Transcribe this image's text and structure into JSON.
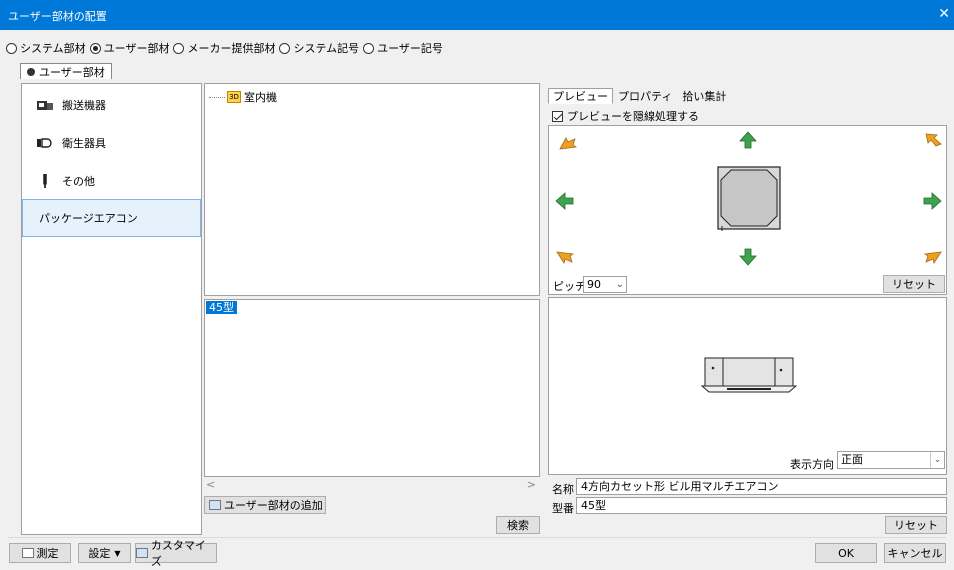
{
  "window": {
    "title": "ユーザー部材の配置",
    "close_glyph": "✕"
  },
  "source_options": [
    {
      "label": "システム部材",
      "selected": false
    },
    {
      "label": "ユーザー部材",
      "selected": true
    },
    {
      "label": "メーカー提供部材",
      "selected": false
    },
    {
      "label": "システム記号",
      "selected": false
    },
    {
      "label": "ユーザー記号",
      "selected": false
    }
  ],
  "source_tab": {
    "label": "ユーザー部材"
  },
  "categories": [
    {
      "label": "搬送機器",
      "icon": "conveyor-icon"
    },
    {
      "label": "衛生器具",
      "icon": "sanitary-icon"
    },
    {
      "label": "その他",
      "icon": "other-icon"
    },
    {
      "label": "パッケージエアコン",
      "icon": "",
      "selected": true
    }
  ],
  "tree": {
    "node_label": "室内機",
    "node_icon_text": "3D"
  },
  "model_list": {
    "items": [
      "45型"
    ]
  },
  "buttons": {
    "add_user_part": "ユーザー部材の追加",
    "search": "検索",
    "pitch_reset": "リセット",
    "field_reset": "リセット",
    "measure": "測定",
    "settings": "設定",
    "customize": "カスタマイズ",
    "ok": "OK",
    "cancel": "キャンセル"
  },
  "right_tabs": [
    {
      "label": "プレビュー",
      "active": true
    },
    {
      "label": "プロパティ",
      "active": false
    },
    {
      "label": "拾い集計",
      "active": false
    }
  ],
  "preview": {
    "hidden_line_label": "プレビューを隠線処理する",
    "hidden_line_checked": true,
    "pitch_label": "ピッチ",
    "pitch_value": "90",
    "direction_label": "表示方向",
    "direction_value": "正面"
  },
  "fields": {
    "name_label": "名称",
    "name_value": "4方向カセット形 ビル用マルチエアコン",
    "model_label": "型番",
    "model_value": "45型"
  },
  "colors": {
    "titlebar": "#0078d7",
    "selection": "#0078d7",
    "arrow_green": "#3fa34d",
    "arrow_orange": "#f0a020"
  }
}
